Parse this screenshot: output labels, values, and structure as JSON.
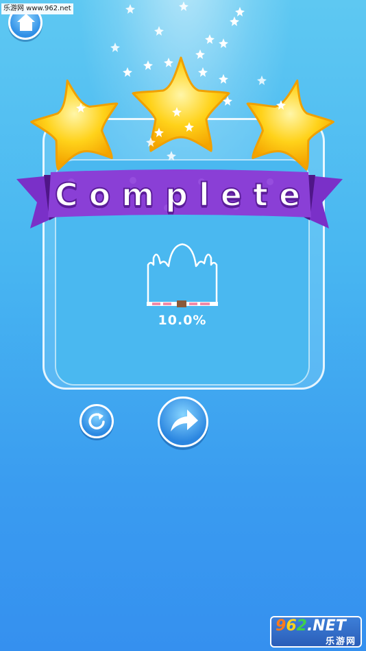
{
  "header": {
    "watermark_text": "乐游网 www.962.net",
    "home_icon": "home-icon"
  },
  "result": {
    "title": "Complete",
    "stars_earned": 3,
    "stars_total": 3,
    "progress_text": "10.0%",
    "progress_value": 0.1
  },
  "controls": {
    "retry_icon": "retry-icon",
    "next_icon": "next-arrow-icon"
  },
  "watermark": {
    "brand_digits": [
      "9",
      "6",
      "2"
    ],
    "brand_suffix": ".NET",
    "brand_sub": "乐游网"
  },
  "colors": {
    "background_top": "#5ec8f2",
    "background_bottom": "#3590ef",
    "star_yellow": "#ffd21a",
    "ribbon_purple": "#8a3fd6",
    "ribbon_dark": "#5b1d99",
    "button_blue": "#2c8ae3"
  }
}
